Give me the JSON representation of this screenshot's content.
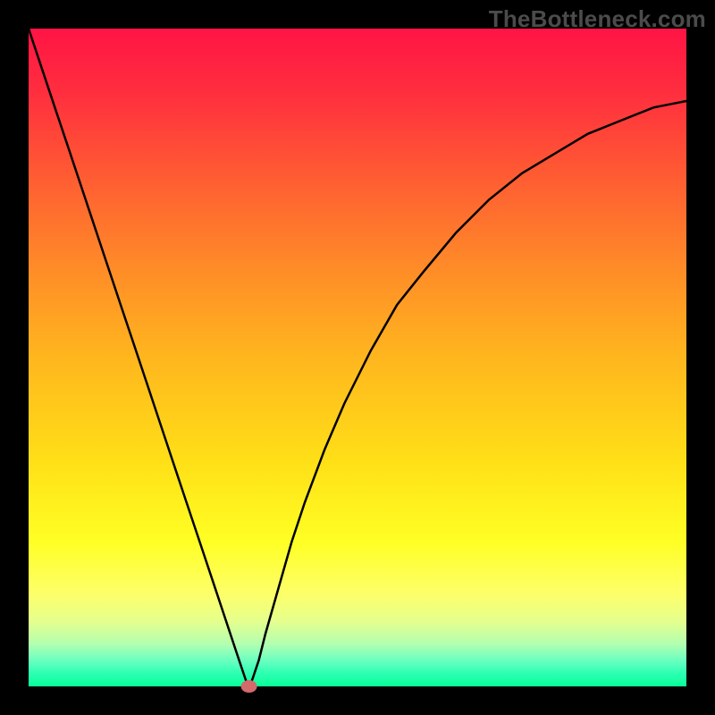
{
  "watermark": "TheBottleneck.com",
  "chart_data": {
    "type": "line",
    "title": "",
    "xlabel": "",
    "ylabel": "",
    "xlim": [
      0,
      100
    ],
    "ylim": [
      0,
      100
    ],
    "grid": false,
    "x": [
      0,
      2,
      4,
      6,
      8,
      10,
      12,
      14,
      16,
      18,
      20,
      22,
      24,
      26,
      28,
      30,
      32,
      33,
      33.5,
      34,
      35,
      36,
      38,
      40,
      42,
      45,
      48,
      52,
      56,
      60,
      65,
      70,
      75,
      80,
      85,
      90,
      95,
      100
    ],
    "values": [
      100,
      94,
      88,
      82,
      76,
      70,
      64,
      58,
      52,
      46,
      40,
      34,
      28,
      22,
      16,
      10,
      4,
      1,
      0,
      1,
      4,
      8,
      15,
      22,
      28,
      36,
      43,
      51,
      58,
      63,
      69,
      74,
      78,
      81,
      84,
      86,
      88,
      89
    ],
    "min_marker": {
      "x": 33.5,
      "y": 0
    }
  }
}
